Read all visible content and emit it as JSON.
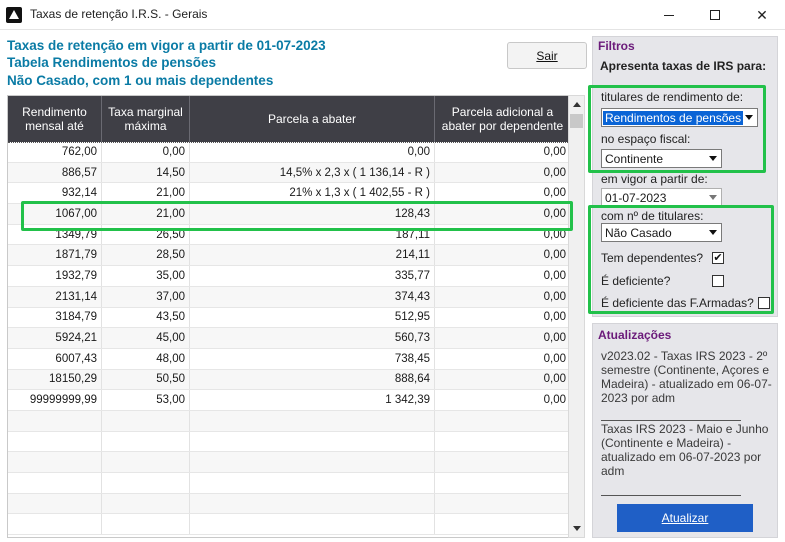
{
  "window": {
    "title": "Taxas de retenção I.R.S. - Gerais",
    "minimize_icon": "minimize-icon",
    "maximize_icon": "maximize-icon",
    "close_icon": "close-icon"
  },
  "header": {
    "line1": "Taxas de retenção em vigor a partir de 01-07-2023",
    "line2": "Tabela Rendimentos de pensões",
    "line3": "Não Casado, com 1 ou mais dependentes",
    "sair_label": "Sair"
  },
  "table": {
    "columns": [
      "Rendimento mensal até",
      "Taxa marginal máxima",
      "Parcela a abater",
      "Parcela adicional a abater por dependente"
    ],
    "rows": [
      [
        "762,00",
        "0,00",
        "0,00",
        "0,00"
      ],
      [
        "886,57",
        "14,50",
        "14,5% x 2,3 x ( 1 136,14 - R )",
        "0,00"
      ],
      [
        "932,14",
        "21,00",
        "21% x 1,3 x ( 1 402,55 - R )",
        "0,00"
      ],
      [
        "1067,00",
        "21,00",
        "128,43",
        "0,00"
      ],
      [
        "1349,79",
        "26,50",
        "187,11",
        "0,00"
      ],
      [
        "1871,79",
        "28,50",
        "214,11",
        "0,00"
      ],
      [
        "1932,79",
        "35,00",
        "335,77",
        "0,00"
      ],
      [
        "2131,14",
        "37,00",
        "374,43",
        "0,00"
      ],
      [
        "3184,79",
        "43,50",
        "512,95",
        "0,00"
      ],
      [
        "5924,21",
        "45,00",
        "560,73",
        "0,00"
      ],
      [
        "6007,43",
        "48,00",
        "738,45",
        "0,00"
      ],
      [
        "18150,29",
        "50,50",
        "888,64",
        "0,00"
      ],
      [
        "99999999,99",
        "53,00",
        "1 342,39",
        "0,00"
      ],
      [
        "",
        "",
        "",
        ""
      ],
      [
        "",
        "",
        "",
        ""
      ],
      [
        "",
        "",
        "",
        ""
      ],
      [
        "",
        "",
        "",
        ""
      ],
      [
        "",
        "",
        "",
        ""
      ],
      [
        "",
        "",
        "",
        ""
      ]
    ]
  },
  "filtros": {
    "title": "Filtros",
    "subtitle": "Apresenta taxas de IRS para:",
    "titulares_label": "titulares de rendimento de:",
    "titulares_value": "Rendimentos de pensões",
    "espaco_label": "no espaço fiscal:",
    "espaco_value": "Continente",
    "vigor_label": "em vigor a partir de:",
    "vigor_value": "01-07-2023",
    "num_titulares_label": "com nº de titulares:",
    "num_titulares_value": "Não Casado",
    "dependentes_label": "Tem dependentes?",
    "dependentes_checked": "✔",
    "deficiente_label": "É deficiente?",
    "deficiente_armadas_label": "É deficiente das F.Armadas?"
  },
  "atualizacoes": {
    "title": "Atualizações",
    "entry1": "v2023.02 - Taxas IRS 2023 - 2º semestre (Continente, Açores e Madeira) - atualizado em 06-07-2023 por adm",
    "entry2": "Taxas IRS 2023 - Maio e Junho (Continente e Madeira) - atualizado em 06-07-2023 por adm",
    "button_label": "Atualizar"
  },
  "colors": {
    "header_text": "#0a7ba5",
    "panel_title": "#6b1a7a",
    "table_header_bg": "#3f3f46",
    "highlight": "#22c14a",
    "button_blue": "#1f5fc6"
  }
}
